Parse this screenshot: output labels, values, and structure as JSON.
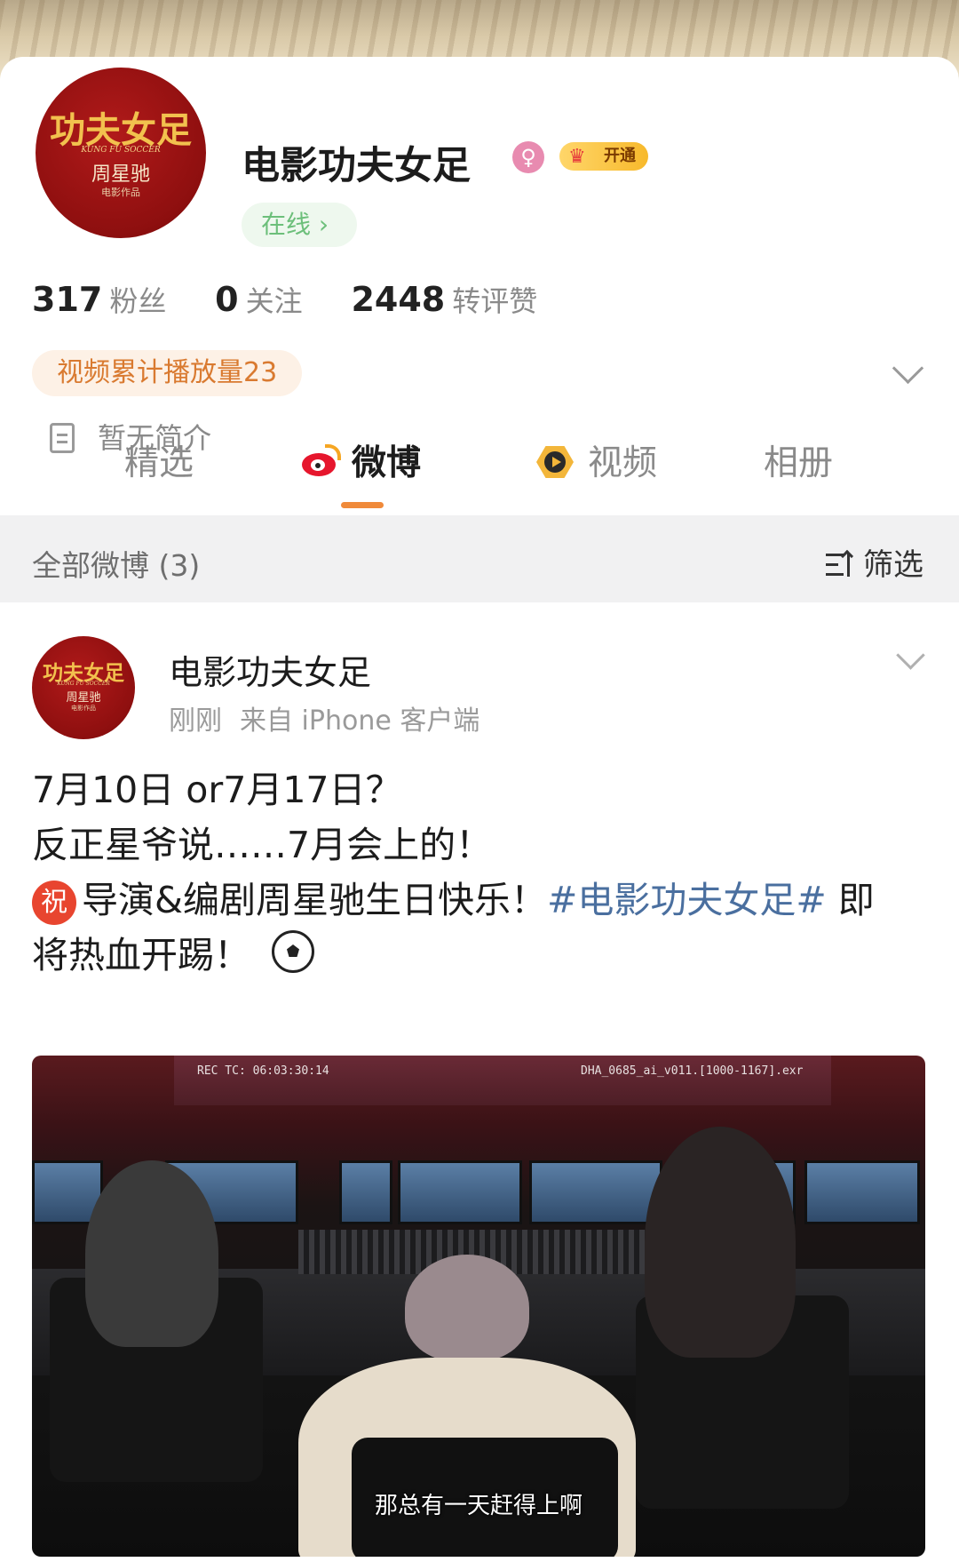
{
  "profile": {
    "name": "电影功夫女足",
    "vip_label": "开通",
    "online_label": "在线 ›",
    "avatar_logo": {
      "title": "功夫女足",
      "subtitle": "KUNG FU SOCCER",
      "director": "周星驰",
      "note": "电影作品"
    },
    "stats": [
      {
        "value": "317",
        "label": "粉丝"
      },
      {
        "value": "0",
        "label": "关注"
      },
      {
        "value": "2448",
        "label": "转评赞"
      }
    ],
    "play_count_badge": "视频累计播放量23",
    "bio": "暂无简介"
  },
  "tabs": [
    {
      "label": "精选",
      "icon": null
    },
    {
      "label": "微博",
      "icon": "weibo-icon",
      "active": true
    },
    {
      "label": "视频",
      "icon": "video-icon"
    },
    {
      "label": "相册",
      "icon": null
    }
  ],
  "filter_bar": {
    "title": "全部微博 (3)",
    "filter_label": "筛选"
  },
  "post": {
    "author": "电影功夫女足",
    "time": "刚刚",
    "source": "来自 iPhone 客户端",
    "line1": "7月10日 or7月17日？",
    "line2": "反正星爷说……7月会上的！",
    "zhu_icon_text": "祝",
    "line3_text": "导演&编剧周星驰生日快乐！",
    "hashtag": "#电影功夫女足#",
    "line3_tail": " 即",
    "line4": "将热血开踢！",
    "image": {
      "screen_left_text": "REC TC: 06:03:30:14",
      "screen_right_text": "DHA_0685_ai_v011.[1000-1167].exr",
      "subtitle": "那总有一天赶得上啊"
    }
  },
  "colors": {
    "accent_orange": "#f08a3a",
    "weibo_red": "#e6162d",
    "hashtag_blue": "#4a6f9f",
    "online_green": "#6cbf7a",
    "badge_orange_text": "#d97a30"
  }
}
